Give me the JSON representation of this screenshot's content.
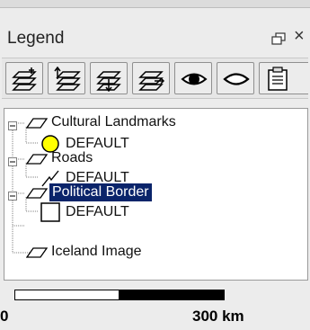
{
  "panel": {
    "title": "Legend",
    "close_glyph": "×"
  },
  "toolbar": {
    "buttons": [
      {
        "name": "add-layer-icon"
      },
      {
        "name": "move-layer-up-icon"
      },
      {
        "name": "move-layer-down-icon"
      },
      {
        "name": "layer-properties-icon"
      },
      {
        "name": "eye-icon"
      },
      {
        "name": "hide-layer-icon"
      },
      {
        "name": "legend-properties-icon"
      }
    ]
  },
  "tree": {
    "items": [
      {
        "label": "Cultural Landmarks",
        "expanded": true,
        "class_label": "DEFAULT",
        "symbol": "yellow-circle"
      },
      {
        "label": "Roads",
        "expanded": true,
        "class_label": "DEFAULT",
        "symbol": "line"
      },
      {
        "label": "Political Border",
        "expanded": true,
        "selected": true,
        "class_label": "DEFAULT",
        "symbol": "square"
      },
      {
        "label": "Iceland Image",
        "expanded": false
      }
    ]
  },
  "scale": {
    "start_label": "0",
    "end_label": "300 km"
  },
  "colors": {
    "selection": "#0a246a",
    "landmark_symbol": "#ffff00"
  }
}
